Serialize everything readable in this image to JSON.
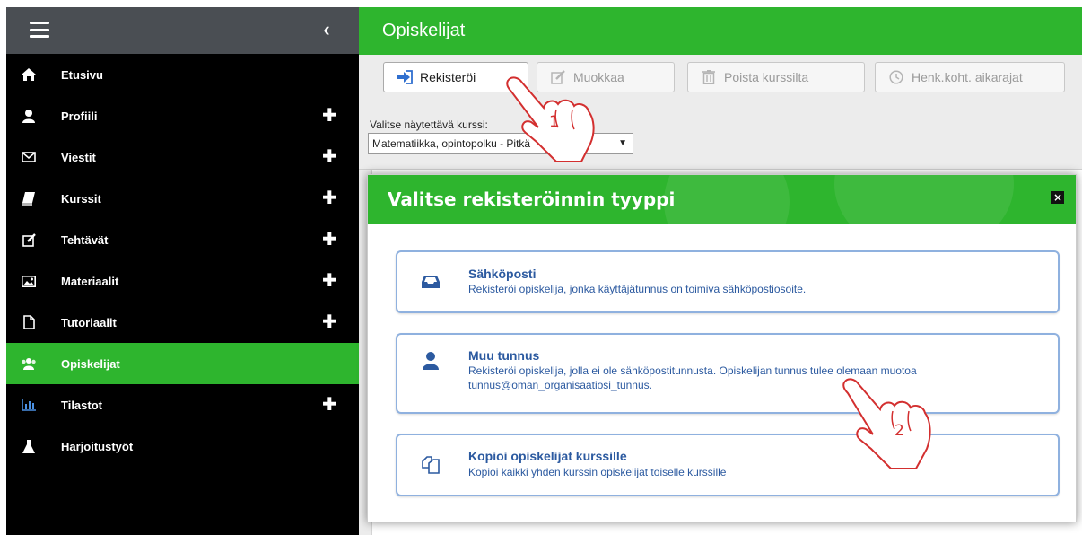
{
  "sidebar": {
    "items": [
      {
        "label": "Etusivu",
        "icon": "home-icon",
        "expandable": false,
        "active": false
      },
      {
        "label": "Profiili",
        "icon": "user-icon",
        "expandable": true,
        "active": false
      },
      {
        "label": "Viestit",
        "icon": "envelope-icon",
        "expandable": true,
        "active": false
      },
      {
        "label": "Kurssit",
        "icon": "book-icon",
        "expandable": true,
        "active": false
      },
      {
        "label": "Tehtävät",
        "icon": "edit-icon",
        "expandable": true,
        "active": false
      },
      {
        "label": "Materiaalit",
        "icon": "image-icon",
        "expandable": true,
        "active": false
      },
      {
        "label": "Tutoriaalit",
        "icon": "file-icon",
        "expandable": true,
        "active": false
      },
      {
        "label": "Opiskelijat",
        "icon": "users-icon",
        "expandable": false,
        "active": true
      },
      {
        "label": "Tilastot",
        "icon": "bar-chart-icon",
        "expandable": true,
        "active": false
      },
      {
        "label": "Harjoitustyöt",
        "icon": "flask-icon",
        "expandable": false,
        "active": false
      }
    ],
    "plus_glyph": "✚"
  },
  "header": {
    "title": "Opiskelijat"
  },
  "toolbar": {
    "register_label": "Rekisteröi",
    "edit_label": "Muokkaa",
    "remove_label": "Poista kurssilta",
    "deadlines_label": "Henk.koht. aikarajat"
  },
  "course_select": {
    "label": "Valitse näytettävä kurssi:",
    "value": "Matematiikka, opintopolku ‑ Pitkä"
  },
  "modal": {
    "title": "Valitse rekisteröinnin tyyppi",
    "close_glyph": "×",
    "options": [
      {
        "title": "Sähköposti",
        "description": "Rekisteröi opiskelija, jonka käyttäjätunnus on toimiva sähköpostiosoite."
      },
      {
        "title": "Muu tunnus",
        "description": "Rekisteröi opiskelija, jolla ei ole sähköpostitunnusta. Opiskelijan tunnus tulee olemaan muotoa tunnus@oman_organisaatiosi_tunnus."
      },
      {
        "title": "Kopioi opiskelijat kurssille",
        "description": "Kopioi kaikki yhden kurssin opiskelijat toiselle kurssille"
      }
    ]
  },
  "annotations": {
    "step1": "1",
    "step2": "2"
  },
  "colors": {
    "brand_green": "#2eb52e",
    "sidebar_bg": "#000000",
    "sidebar_header": "#4a4e53",
    "option_text": "#2c5aa0",
    "option_border": "#8fb1df",
    "annotation_red": "#d32f2f"
  }
}
